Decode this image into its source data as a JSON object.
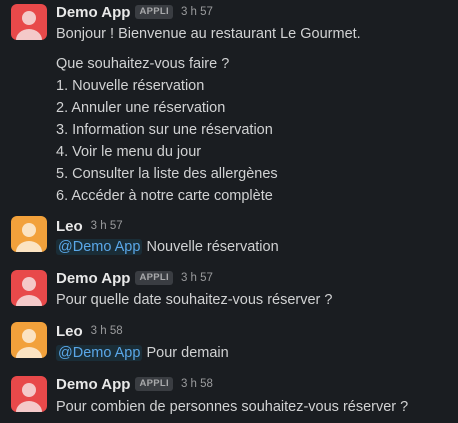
{
  "messages": [
    {
      "author": "Demo App",
      "badge": "APPLI",
      "time": "3 h 57",
      "lines": [
        "Bonjour ! Bienvenue au restaurant Le Gourmet.",
        "Que souhaitez-vous faire ?",
        "1. Nouvelle réservation",
        "2. Annuler une réservation",
        "3. Information sur une réservation",
        "4. Voir le menu du jour",
        "5. Consulter la liste des allergènes",
        "6. Accéder à notre carte complète"
      ]
    },
    {
      "author": "Leo",
      "time": "3 h 57",
      "mention": "@Demo App",
      "text": "Nouvelle réservation"
    },
    {
      "author": "Demo App",
      "badge": "APPLI",
      "time": "3 h 57",
      "text": "Pour quelle date souhaitez-vous réserver ?"
    },
    {
      "author": "Leo",
      "time": "3 h 58",
      "mention": "@Demo App",
      "text": "Pour demain"
    },
    {
      "author": "Demo App",
      "badge": "APPLI",
      "time": "3 h 58",
      "text": "Pour combien de personnes souhaitez-vous réserver ?"
    }
  ],
  "colors": {
    "background": "#1a1d21",
    "bot_avatar": "#e8494a",
    "user_avatar": "#f2a13b",
    "mention": "#5aa7e8"
  },
  "icons": {
    "avatar": "person-silhouette-icon"
  }
}
